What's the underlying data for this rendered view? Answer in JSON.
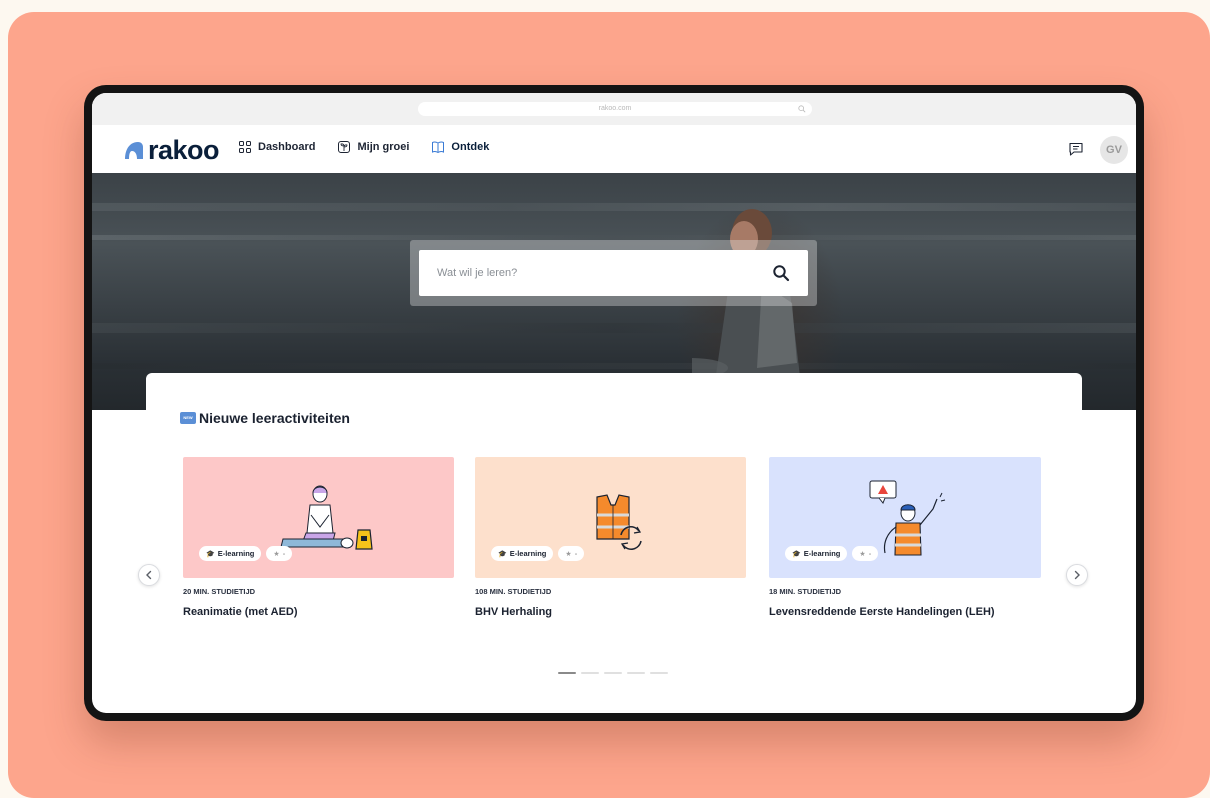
{
  "browser": {
    "url": "rakoo.com"
  },
  "app": {
    "logo_text": "rakoo",
    "nav": [
      {
        "label": "Dashboard",
        "icon": "grid-icon"
      },
      {
        "label": "Mijn groei",
        "icon": "growth-icon"
      },
      {
        "label": "Ontdek",
        "icon": "book-icon",
        "active": true
      }
    ],
    "avatar_initials": "GV"
  },
  "hero": {
    "search_placeholder": "Wat wil je leren?"
  },
  "section": {
    "title": "Nieuwe leeractiviteiten",
    "badge": "NEW"
  },
  "cards": [
    {
      "type_label": "E-learning",
      "rating": "-",
      "meta": "20 MIN. STUDIETIJD",
      "title": "Reanimatie (met AED)",
      "bg": "#fdc8c8"
    },
    {
      "type_label": "E-learning",
      "rating": "-",
      "meta": "108 MIN. STUDIETIJD",
      "title": "BHV Herhaling",
      "bg": "#fde0cc"
    },
    {
      "type_label": "E-learning",
      "rating": "-",
      "meta": "18 MIN. STUDIETIJD",
      "title": "Levensreddende Eerste Handelingen (LEH)",
      "bg": "#d9e2fd"
    }
  ],
  "carousel": {
    "pages": 5,
    "active_page": 1
  },
  "colors": {
    "brand": "#0a1f3a",
    "logo_mark": "#5b8fd6",
    "background": "#fda58c"
  }
}
